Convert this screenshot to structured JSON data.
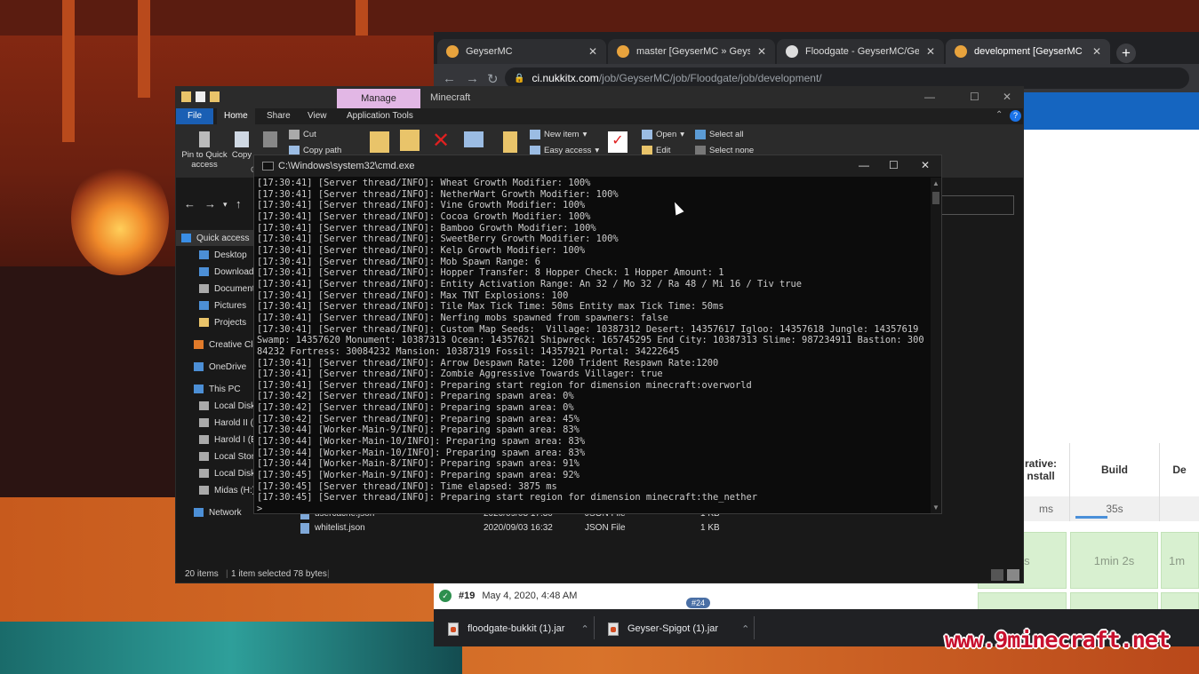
{
  "browser": {
    "tabs": [
      {
        "title": "GeyserMC"
      },
      {
        "title": "master [GeyserMC » Geyser] [Jen"
      },
      {
        "title": "Floodgate - GeyserMC/Geyser W"
      },
      {
        "title": "development [GeyserMC » Flood"
      }
    ],
    "new_tab": "+",
    "url_host": "ci.nukkitx.com",
    "url_path": "/job/GeyserMC/job/Floodgate/job/development/",
    "stages": [
      "rative:\nnstall",
      "Build",
      "De"
    ],
    "stage_times": [
      "ms",
      "35s",
      ""
    ],
    "stage_durations": [
      "ms",
      "1min 2s",
      "1m"
    ],
    "build_row": {
      "number": "#19",
      "date": "May 4, 2020, 4:48 AM"
    },
    "build_badge": "#24",
    "downloads": [
      {
        "name": "floodgate-bukkit (1).jar"
      },
      {
        "name": "Geyser-Spigot (1).jar"
      }
    ]
  },
  "explorer": {
    "manage_tab": "Manage",
    "window_title": "Minecraft",
    "ribbon_tabs": [
      "File",
      "Home",
      "Share",
      "View",
      "Application Tools"
    ],
    "ribbon": {
      "pin": "Pin to Quick access",
      "copy": "Copy",
      "cut": "Cut",
      "copy_path": "Copy path",
      "new_item": "New item",
      "easy_access": "Easy access",
      "open": "Open",
      "edit": "Edit",
      "select_all": "Select all",
      "select_none": "Select none",
      "clip_label": "Cl"
    },
    "sidebar": [
      "Quick access",
      "Desktop",
      "Downloads",
      "Documents",
      "Pictures",
      "Projects",
      "Creative Clou",
      "OneDrive",
      "This PC",
      "Local Disk (",
      "Harold II (D:",
      "Harold I (E:)",
      "Local Storag",
      "Local Disk (",
      "Midas (H:)",
      "Network"
    ],
    "files": [
      {
        "name": "usercache.json",
        "date": "2020/09/03 17:30",
        "type": "JSON File",
        "size": "1 KB"
      },
      {
        "name": "whitelist.json",
        "date": "2020/09/03 16:32",
        "type": "JSON File",
        "size": "1 KB"
      }
    ],
    "status": {
      "count": "20 items",
      "selected": "1 item selected  78 bytes"
    }
  },
  "cmd": {
    "title": "C:\\Windows\\system32\\cmd.exe",
    "lines": [
      "[17:30:41] [Server thread/INFO]: Wheat Growth Modifier: 100%",
      "[17:30:41] [Server thread/INFO]: NetherWart Growth Modifier: 100%",
      "[17:30:41] [Server thread/INFO]: Vine Growth Modifier: 100%",
      "[17:30:41] [Server thread/INFO]: Cocoa Growth Modifier: 100%",
      "[17:30:41] [Server thread/INFO]: Bamboo Growth Modifier: 100%",
      "[17:30:41] [Server thread/INFO]: SweetBerry Growth Modifier: 100%",
      "[17:30:41] [Server thread/INFO]: Kelp Growth Modifier: 100%",
      "[17:30:41] [Server thread/INFO]: Mob Spawn Range: 6",
      "[17:30:41] [Server thread/INFO]: Hopper Transfer: 8 Hopper Check: 1 Hopper Amount: 1",
      "[17:30:41] [Server thread/INFO]: Entity Activation Range: An 32 / Mo 32 / Ra 48 / Mi 16 / Tiv true",
      "[17:30:41] [Server thread/INFO]: Max TNT Explosions: 100",
      "[17:30:41] [Server thread/INFO]: Tile Max Tick Time: 50ms Entity max Tick Time: 50ms",
      "[17:30:41] [Server thread/INFO]: Nerfing mobs spawned from spawners: false",
      "[17:30:41] [Server thread/INFO]: Custom Map Seeds:  Village: 10387312 Desert: 14357617 Igloo: 14357618 Jungle: 14357619",
      "Swamp: 14357620 Monument: 10387313 Ocean: 14357621 Shipwreck: 165745295 End City: 10387313 Slime: 987234911 Bastion: 300",
      "84232 Fortress: 30084232 Mansion: 10387319 Fossil: 14357921 Portal: 34222645",
      "[17:30:41] [Server thread/INFO]: Arrow Despawn Rate: 1200 Trident Respawn Rate:1200",
      "[17:30:41] [Server thread/INFO]: Zombie Aggressive Towards Villager: true",
      "[17:30:41] [Server thread/INFO]: Preparing start region for dimension minecraft:overworld",
      "[17:30:42] [Server thread/INFO]: Preparing spawn area: 0%",
      "[17:30:42] [Server thread/INFO]: Preparing spawn area: 0%",
      "[17:30:42] [Server thread/INFO]: Preparing spawn area: 45%",
      "[17:30:44] [Worker-Main-9/INFO]: Preparing spawn area: 83%",
      "[17:30:44] [Worker-Main-10/INFO]: Preparing spawn area: 83%",
      "[17:30:44] [Worker-Main-10/INFO]: Preparing spawn area: 83%",
      "[17:30:44] [Worker-Main-8/INFO]: Preparing spawn area: 91%",
      "[17:30:45] [Worker-Main-9/INFO]: Preparing spawn area: 92%",
      "[17:30:45] [Server thread/INFO]: Time elapsed: 3875 ms",
      "[17:30:45] [Server thread/INFO]: Preparing start region for dimension minecraft:the_nether",
      ">"
    ]
  },
  "watermark": "www.9minecraft.net",
  "colors": {
    "accent_blue": "#1565c0",
    "manage_pink": "#e2b7e5",
    "watermark_red": "#c8102e"
  }
}
